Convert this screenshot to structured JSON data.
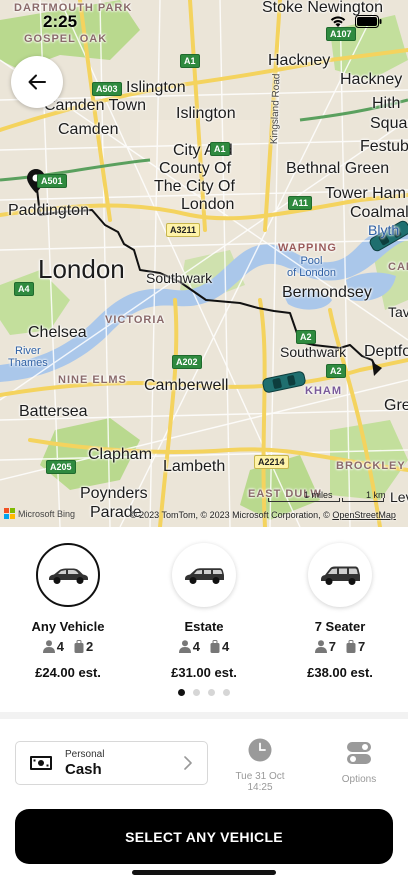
{
  "status_bar": {
    "time": "2:25"
  },
  "map": {
    "places": [
      "DARTMOUTH PARK",
      "Stoke Newington",
      "GOSPEL OAK",
      "Islington",
      "Camden Town",
      "Islington",
      "Hackney",
      "Hackney",
      "Camden",
      "Hith",
      "Squar",
      "City And",
      "County Of",
      "The City Of",
      "London",
      "Bethnal Green",
      "Festube",
      "Paddington",
      "Tower Ham",
      "Coalmal",
      "London",
      "Southwark",
      "Blyth",
      "Bermondsey",
      "Chelsea",
      "VICTORIA",
      "Tav",
      "Southwark",
      "Deptfo",
      "Camberwell",
      "NINE ELMS",
      "Battersea",
      "Gre",
      "Clapham",
      "Lambeth",
      "BROCKLEY",
      "Poynders",
      "Parade",
      "EAST DULW",
      "Lev",
      "CAN"
    ],
    "water": {
      "river_thames": "River\nThames",
      "wapping": "WAPPING",
      "pool": "Pool\nof London",
      "kham": "KHAM"
    },
    "roads": [
      "A1",
      "A107",
      "A503",
      "A1",
      "A501",
      "A3211",
      "A11",
      "A4",
      "A202",
      "A2",
      "A205",
      "A2214",
      "A2"
    ],
    "road_vertical": "Kingsland Road",
    "scale": {
      "miles": "1 miles",
      "km": "1 km"
    },
    "attribution_prefix": "© 2023 TomTom, © 2023 Microsoft Corporation, © ",
    "attribution_link": "OpenStreetMap",
    "bing": "Microsoft Bing"
  },
  "vehicles": [
    {
      "name": "Any Vehicle",
      "passengers": "4",
      "luggage": "2",
      "price": "£24.00 est.",
      "selected": true
    },
    {
      "name": "Estate",
      "passengers": "4",
      "luggage": "4",
      "price": "£31.00 est.",
      "selected": false
    },
    {
      "name": "7 Seater",
      "passengers": "7",
      "luggage": "7",
      "price": "£38.00 est.",
      "selected": false
    }
  ],
  "carousel": {
    "page_count": 4,
    "active_index": 0
  },
  "payment": {
    "type": "Personal",
    "method": "Cash"
  },
  "schedule": {
    "date": "Tue 31 Oct",
    "time": "14:25"
  },
  "options": {
    "label": "Options"
  },
  "cta": {
    "label": "SELECT ANY VEHICLE"
  },
  "colors": {
    "primary": "#000000",
    "route": "#111111",
    "vehicle_marker": "#1f6f6f",
    "muted": "#999999"
  }
}
